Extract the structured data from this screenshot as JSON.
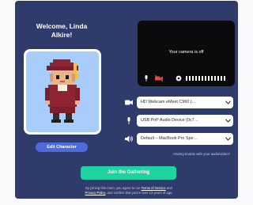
{
  "header": {
    "welcome_line1": "Welcome, Linda",
    "welcome_line2": "Alkire!"
  },
  "avatar": {
    "edit_label": "Edit Character"
  },
  "preview": {
    "camera_off_text": "Your camera is off"
  },
  "devices": {
    "camera": "HD Webcam eMeet C960 (…",
    "microphone": "USB PnP Audio Device (0c7…",
    "speaker": "Default – MacBook Pro Spe…",
    "trouble_text": "Having trouble with your audio/video?"
  },
  "join": {
    "label": "Join the Gathering"
  },
  "legal": {
    "part1": "By joining this room, you agree to our ",
    "terms": "Terms of Service",
    "and": " and",
    "privacy": "Privacy Policy",
    "part2": ", and confirm that you're over 13 years of age."
  },
  "colors": {
    "panel": "#2f3b6b",
    "avatar_bg": "#a9cdfb",
    "edit_button": "#4f6bdb",
    "join_button": "#1fd3a0"
  },
  "icons": [
    "mic-icon",
    "camera-off-icon",
    "volume-icon",
    "volume-meter-icon",
    "camera-icon",
    "speaker-icon",
    "chevron-down-icon"
  ]
}
